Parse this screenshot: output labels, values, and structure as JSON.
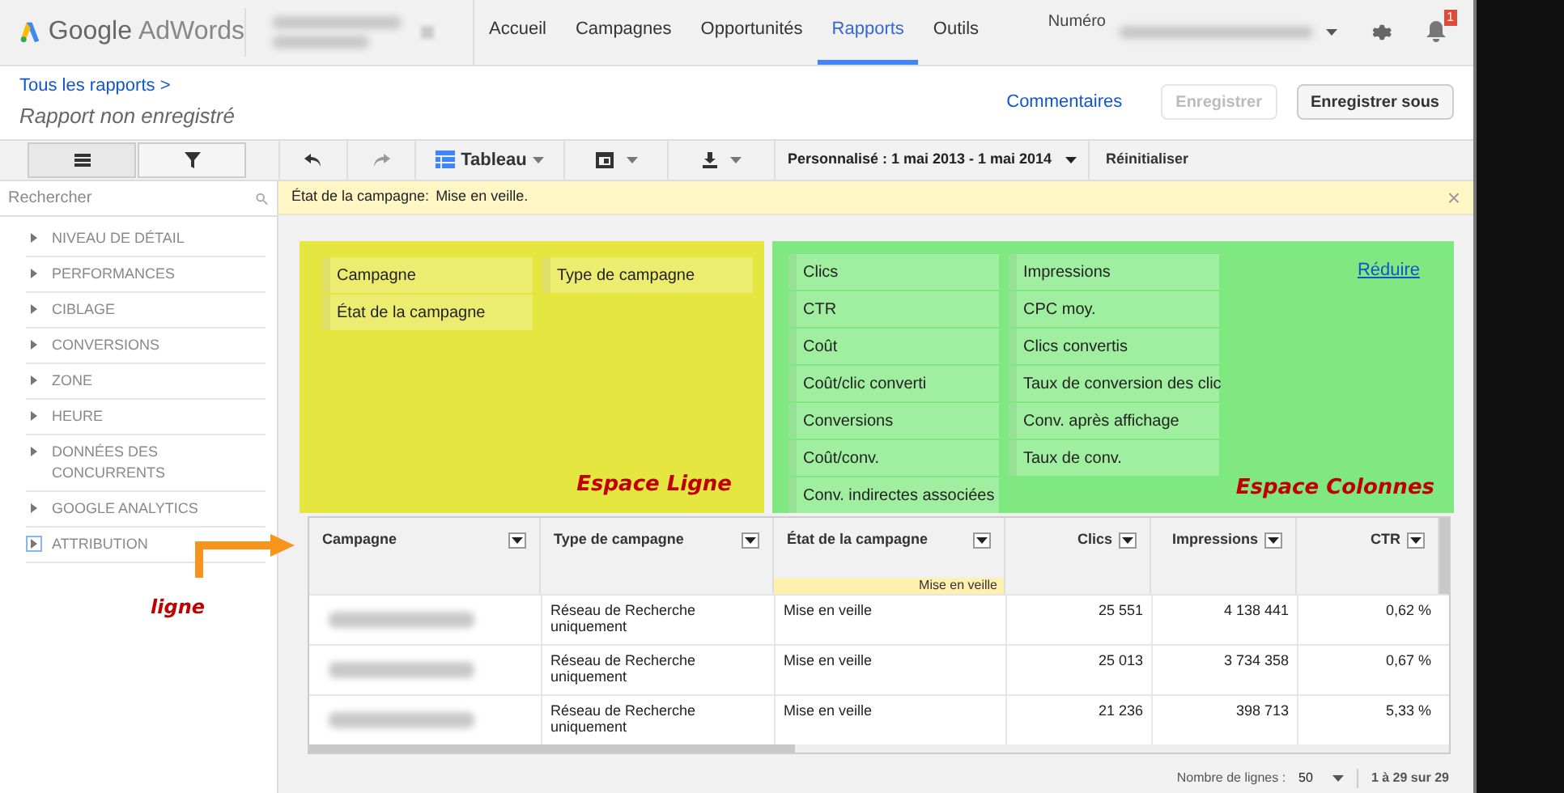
{
  "header": {
    "logo": {
      "brand": "Google",
      "product": "AdWords"
    },
    "nav": [
      {
        "label": "Accueil",
        "selected": false
      },
      {
        "label": "Campagnes",
        "selected": false
      },
      {
        "label": "Opportunités",
        "selected": false
      },
      {
        "label": "Rapports",
        "selected": true
      },
      {
        "label": "Outils",
        "selected": false
      }
    ],
    "account_label": "Numéro",
    "notification_badge": "1"
  },
  "report": {
    "breadcrumb": "Tous les rapports >",
    "title": "Rapport non enregistré",
    "feedback_link": "Commentaires",
    "buttons": [
      {
        "label": "Enregistrer",
        "disabled": true
      },
      {
        "label": "Enregistrer sous",
        "disabled": false
      }
    ]
  },
  "toolbar": {
    "view": "Tableau",
    "date_range": "Personnalisé : 1 mai 2013 - 1 mai 2014",
    "reset": "Réinitialiser"
  },
  "sidebar": {
    "search_placeholder": "Rechercher",
    "items": [
      {
        "label": "NIVEAU DE DÉTAIL",
        "focused": false
      },
      {
        "label": "PERFORMANCES",
        "focused": false
      },
      {
        "label": "CIBLAGE",
        "focused": false
      },
      {
        "label": "CONVERSIONS",
        "focused": false
      },
      {
        "label": "ZONE",
        "focused": false
      },
      {
        "label": "HEURE",
        "focused": false
      },
      {
        "label": "DONNÉES DES CONCURRENTS",
        "focused": false
      },
      {
        "label": "GOOGLE ANALYTICS",
        "focused": false
      },
      {
        "label": "ATTRIBUTION",
        "focused": true
      }
    ]
  },
  "banner": {
    "label": "État de la campagne:",
    "value": "Mise en veille.",
    "close": "×"
  },
  "row_space": {
    "annotation": "Espace Ligne",
    "chips": [
      [
        "Campagne",
        "État de la campagne"
      ],
      [
        "Type de campagne"
      ]
    ]
  },
  "column_space": {
    "annotation": "Espace Colonnes",
    "collapse_link": "Réduire",
    "chips": [
      [
        "Clics",
        "CTR",
        "Coût",
        "Coût/clic converti",
        "Conversions",
        "Coût/conv.",
        "Conv. indirectes associées"
      ],
      [
        "Impressions",
        "CPC moy.",
        "Clics convertis",
        "Taux de conversion des clic",
        "Conv. après affichage",
        "Taux de conv."
      ]
    ]
  },
  "table": {
    "columns": [
      {
        "label": "Campagne"
      },
      {
        "label": "Type de campagne"
      },
      {
        "label": "État de la campagne",
        "filter": "Mise en veille"
      },
      {
        "label": "Clics"
      },
      {
        "label": "Impressions"
      },
      {
        "label": "CTR"
      }
    ],
    "rows": [
      [
        "",
        "Réseau de Recherche uniquement",
        "Mise en veille",
        "25 551",
        "4 138 441",
        "0,62 %"
      ],
      [
        "",
        "Réseau de Recherche uniquement",
        "Mise en veille",
        "25 013",
        "3 734 358",
        "0,67 %"
      ],
      [
        "",
        "Réseau de Recherche uniquement",
        "Mise en veille",
        "21 236",
        "398 713",
        "5,33 %"
      ]
    ]
  },
  "footer": {
    "rows_label": "Nombre de lignes :",
    "rows_value": "50",
    "range": "1 à 29 sur 29"
  },
  "annotation": "ligne"
}
